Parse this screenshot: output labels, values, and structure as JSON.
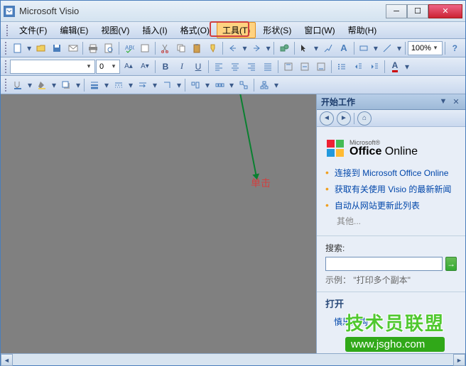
{
  "title": "Microsoft Visio",
  "menu": {
    "file": "文件(F)",
    "edit": "编辑(E)",
    "view": "视图(V)",
    "insert": "插入(I)",
    "format": "格式(O)",
    "tools": "工具(T)",
    "shape": "形状(S)",
    "window": "窗口(W)",
    "help": "帮助(H)"
  },
  "toolbar": {
    "zoom": "100%",
    "font_name": "",
    "font_size": "0"
  },
  "annotation": {
    "text": "单击"
  },
  "sidepanel": {
    "header": "开始工作",
    "office_small": "Microsoft®",
    "office_bold": "Office",
    "office_rest": " Online",
    "links": [
      "连接到 Microsoft Office Online",
      "获取有关使用 Visio 的最新新闻",
      "自动从网站更新此列表"
    ],
    "more": "其他...",
    "search_label": "搜索:",
    "search_value": "",
    "example": "示例： \"打印多个副本\"",
    "open_title": "打开",
    "open_items": [
      "慎思结构"
    ]
  },
  "watermark": {
    "cn": "技术员联盟",
    "url": "www.jsgho.com"
  }
}
